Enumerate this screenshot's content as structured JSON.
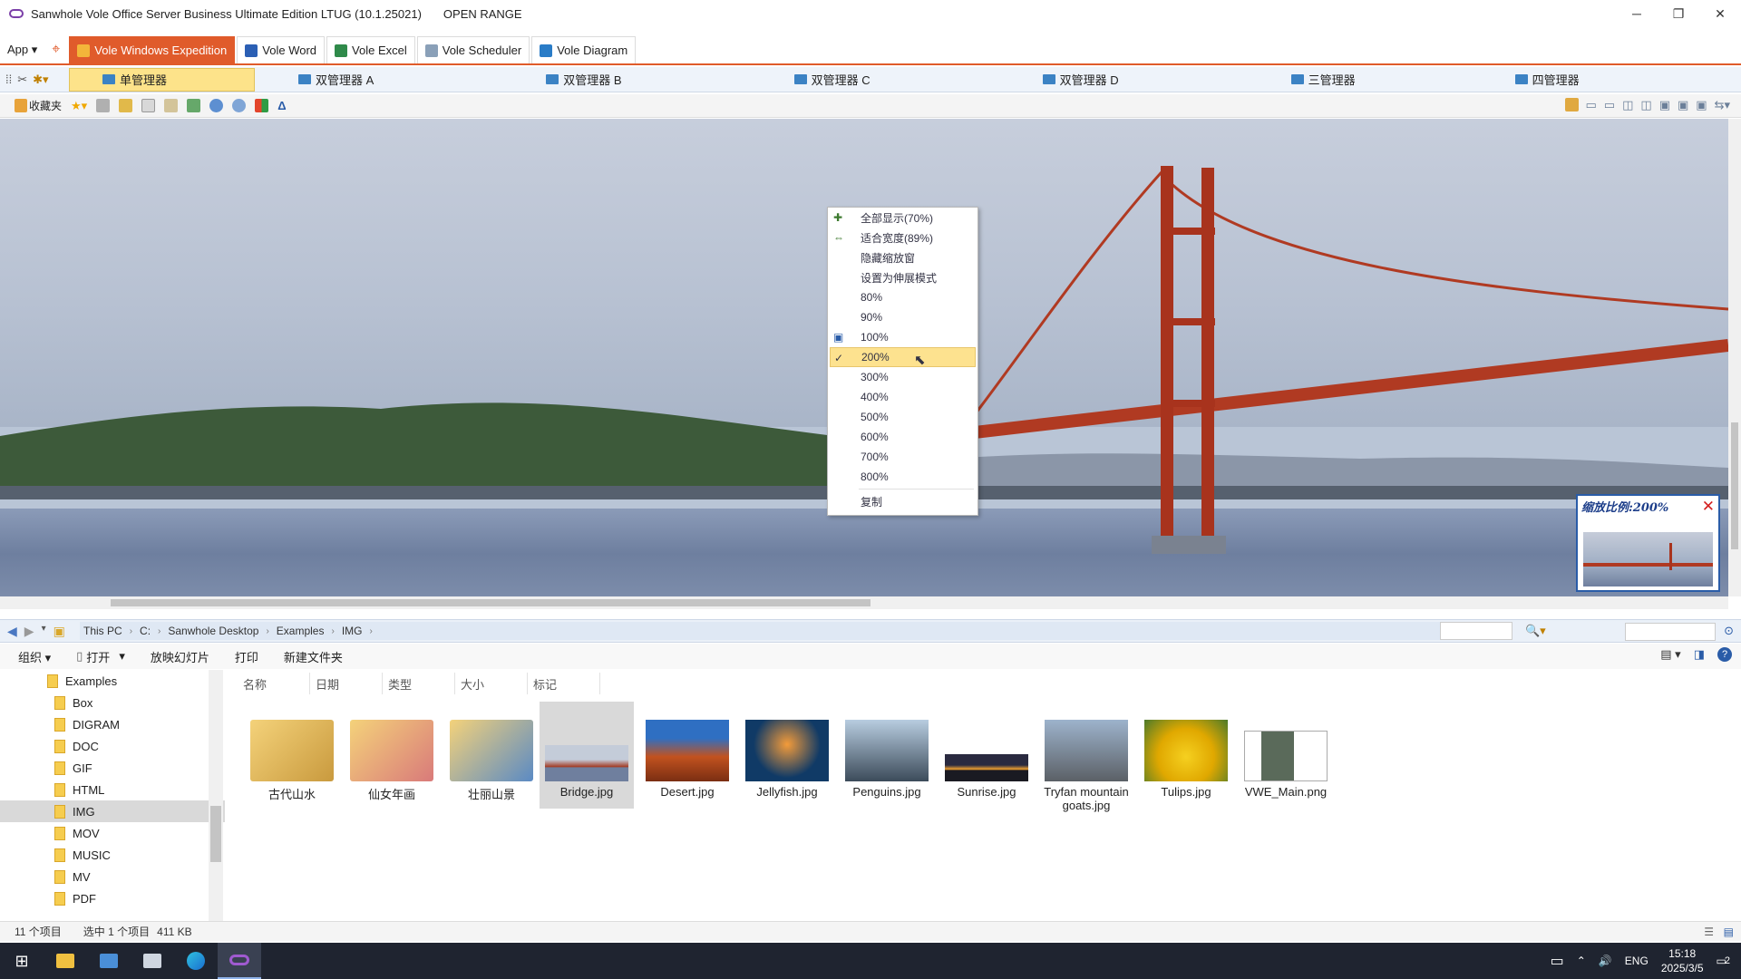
{
  "window": {
    "title": "Sanwhole Vole Office Server Business Ultimate Edition LTUG (10.1.25021)",
    "subtitle": "OPEN RANGE",
    "controls": {
      "minimize": "─",
      "restore": "❐",
      "close": "✕"
    }
  },
  "app_tabs": {
    "app_menu": "App ▾",
    "tabs": [
      {
        "label": "Vole Windows Expedition",
        "active": true
      },
      {
        "label": "Vole Word"
      },
      {
        "label": "Vole Excel"
      },
      {
        "label": "Vole Scheduler"
      },
      {
        "label": "Vole Diagram"
      }
    ]
  },
  "manager_tabs": [
    {
      "label": "单管理器",
      "active": true
    },
    {
      "label": "双管理器 A"
    },
    {
      "label": "双管理器 B"
    },
    {
      "label": "双管理器 C"
    },
    {
      "label": "双管理器 D"
    },
    {
      "label": "三管理器"
    },
    {
      "label": "四管理器"
    }
  ],
  "toolbar": {
    "favorites": "收藏夹"
  },
  "context_menu": {
    "items": [
      {
        "label": "全部显示(70%)",
        "icon": "fit-all-icon"
      },
      {
        "label": "适合宽度(89%)",
        "icon": "fit-width-icon"
      },
      {
        "label": "隐藏缩放窗"
      },
      {
        "label": "设置为伸展模式"
      },
      {
        "label": "80%"
      },
      {
        "label": "90%"
      },
      {
        "label": "100%",
        "icon": "actual-size-icon"
      },
      {
        "label": "200%",
        "checked": true
      },
      {
        "label": "300%"
      },
      {
        "label": "400%"
      },
      {
        "label": "500%"
      },
      {
        "label": "600%"
      },
      {
        "label": "700%"
      },
      {
        "label": "800%"
      },
      {
        "label": "复制"
      }
    ]
  },
  "zoom_popup": {
    "label": "缩放比例:200%"
  },
  "address": {
    "path": [
      "This PC",
      "C:",
      "Sanwhole Desktop",
      "Examples",
      "IMG"
    ]
  },
  "commands": {
    "organize": "组织 ▾",
    "open": "打开",
    "slideshow": "放映幻灯片",
    "print": "打印",
    "new_folder": "新建文件夹"
  },
  "tree": {
    "root": "Examples",
    "items": [
      "Box",
      "DIGRAM",
      "DOC",
      "GIF",
      "HTML",
      "IMG",
      "MOV",
      "MUSIC",
      "MV",
      "PDF"
    ],
    "selected": "IMG"
  },
  "columns": [
    "名称",
    "日期",
    "类型",
    "大小",
    "标记"
  ],
  "files": [
    {
      "name": "古代山水",
      "kind": "folder"
    },
    {
      "name": "仙女年画",
      "kind": "folder"
    },
    {
      "name": "壮丽山景",
      "kind": "folder"
    },
    {
      "name": "Bridge.jpg",
      "kind": "image",
      "selected": true
    },
    {
      "name": "Desert.jpg",
      "kind": "image"
    },
    {
      "name": "Jellyfish.jpg",
      "kind": "image"
    },
    {
      "name": "Penguins.jpg",
      "kind": "image"
    },
    {
      "name": "Sunrise.jpg",
      "kind": "image"
    },
    {
      "name": "Tryfan mountain goats.jpg",
      "kind": "image"
    },
    {
      "name": "Tulips.jpg",
      "kind": "image"
    },
    {
      "name": "VWE_Main.png",
      "kind": "image"
    }
  ],
  "status": {
    "count": "11 个项目",
    "selection": "选中 1 个项目",
    "size": "411 KB"
  },
  "taskbar": {
    "lang": "ENG",
    "time": "15:18",
    "date": "2025/3/5",
    "notifications": "2"
  },
  "colors": {
    "accent": "#e05b2b",
    "selected_tab": "#fde38a",
    "menu_highlight": "#fde28f"
  }
}
